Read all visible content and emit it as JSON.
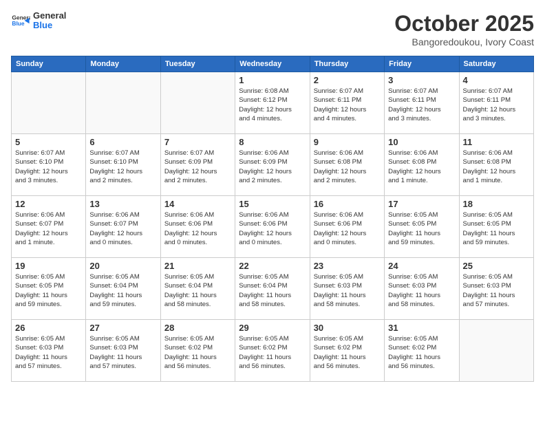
{
  "header": {
    "logo_general": "General",
    "logo_blue": "Blue",
    "month_title": "October 2025",
    "location": "Bangoredoukou, Ivory Coast"
  },
  "weekdays": [
    "Sunday",
    "Monday",
    "Tuesday",
    "Wednesday",
    "Thursday",
    "Friday",
    "Saturday"
  ],
  "weeks": [
    [
      {
        "day": "",
        "info": ""
      },
      {
        "day": "",
        "info": ""
      },
      {
        "day": "",
        "info": ""
      },
      {
        "day": "1",
        "info": "Sunrise: 6:08 AM\nSunset: 6:12 PM\nDaylight: 12 hours\nand 4 minutes."
      },
      {
        "day": "2",
        "info": "Sunrise: 6:07 AM\nSunset: 6:11 PM\nDaylight: 12 hours\nand 4 minutes."
      },
      {
        "day": "3",
        "info": "Sunrise: 6:07 AM\nSunset: 6:11 PM\nDaylight: 12 hours\nand 3 minutes."
      },
      {
        "day": "4",
        "info": "Sunrise: 6:07 AM\nSunset: 6:11 PM\nDaylight: 12 hours\nand 3 minutes."
      }
    ],
    [
      {
        "day": "5",
        "info": "Sunrise: 6:07 AM\nSunset: 6:10 PM\nDaylight: 12 hours\nand 3 minutes."
      },
      {
        "day": "6",
        "info": "Sunrise: 6:07 AM\nSunset: 6:10 PM\nDaylight: 12 hours\nand 2 minutes."
      },
      {
        "day": "7",
        "info": "Sunrise: 6:07 AM\nSunset: 6:09 PM\nDaylight: 12 hours\nand 2 minutes."
      },
      {
        "day": "8",
        "info": "Sunrise: 6:06 AM\nSunset: 6:09 PM\nDaylight: 12 hours\nand 2 minutes."
      },
      {
        "day": "9",
        "info": "Sunrise: 6:06 AM\nSunset: 6:08 PM\nDaylight: 12 hours\nand 2 minutes."
      },
      {
        "day": "10",
        "info": "Sunrise: 6:06 AM\nSunset: 6:08 PM\nDaylight: 12 hours\nand 1 minute."
      },
      {
        "day": "11",
        "info": "Sunrise: 6:06 AM\nSunset: 6:08 PM\nDaylight: 12 hours\nand 1 minute."
      }
    ],
    [
      {
        "day": "12",
        "info": "Sunrise: 6:06 AM\nSunset: 6:07 PM\nDaylight: 12 hours\nand 1 minute."
      },
      {
        "day": "13",
        "info": "Sunrise: 6:06 AM\nSunset: 6:07 PM\nDaylight: 12 hours\nand 0 minutes."
      },
      {
        "day": "14",
        "info": "Sunrise: 6:06 AM\nSunset: 6:06 PM\nDaylight: 12 hours\nand 0 minutes."
      },
      {
        "day": "15",
        "info": "Sunrise: 6:06 AM\nSunset: 6:06 PM\nDaylight: 12 hours\nand 0 minutes."
      },
      {
        "day": "16",
        "info": "Sunrise: 6:06 AM\nSunset: 6:06 PM\nDaylight: 12 hours\nand 0 minutes."
      },
      {
        "day": "17",
        "info": "Sunrise: 6:05 AM\nSunset: 6:05 PM\nDaylight: 11 hours\nand 59 minutes."
      },
      {
        "day": "18",
        "info": "Sunrise: 6:05 AM\nSunset: 6:05 PM\nDaylight: 11 hours\nand 59 minutes."
      }
    ],
    [
      {
        "day": "19",
        "info": "Sunrise: 6:05 AM\nSunset: 6:05 PM\nDaylight: 11 hours\nand 59 minutes."
      },
      {
        "day": "20",
        "info": "Sunrise: 6:05 AM\nSunset: 6:04 PM\nDaylight: 11 hours\nand 59 minutes."
      },
      {
        "day": "21",
        "info": "Sunrise: 6:05 AM\nSunset: 6:04 PM\nDaylight: 11 hours\nand 58 minutes."
      },
      {
        "day": "22",
        "info": "Sunrise: 6:05 AM\nSunset: 6:04 PM\nDaylight: 11 hours\nand 58 minutes."
      },
      {
        "day": "23",
        "info": "Sunrise: 6:05 AM\nSunset: 6:03 PM\nDaylight: 11 hours\nand 58 minutes."
      },
      {
        "day": "24",
        "info": "Sunrise: 6:05 AM\nSunset: 6:03 PM\nDaylight: 11 hours\nand 58 minutes."
      },
      {
        "day": "25",
        "info": "Sunrise: 6:05 AM\nSunset: 6:03 PM\nDaylight: 11 hours\nand 57 minutes."
      }
    ],
    [
      {
        "day": "26",
        "info": "Sunrise: 6:05 AM\nSunset: 6:03 PM\nDaylight: 11 hours\nand 57 minutes."
      },
      {
        "day": "27",
        "info": "Sunrise: 6:05 AM\nSunset: 6:03 PM\nDaylight: 11 hours\nand 57 minutes."
      },
      {
        "day": "28",
        "info": "Sunrise: 6:05 AM\nSunset: 6:02 PM\nDaylight: 11 hours\nand 56 minutes."
      },
      {
        "day": "29",
        "info": "Sunrise: 6:05 AM\nSunset: 6:02 PM\nDaylight: 11 hours\nand 56 minutes."
      },
      {
        "day": "30",
        "info": "Sunrise: 6:05 AM\nSunset: 6:02 PM\nDaylight: 11 hours\nand 56 minutes."
      },
      {
        "day": "31",
        "info": "Sunrise: 6:05 AM\nSunset: 6:02 PM\nDaylight: 11 hours\nand 56 minutes."
      },
      {
        "day": "",
        "info": ""
      }
    ]
  ]
}
